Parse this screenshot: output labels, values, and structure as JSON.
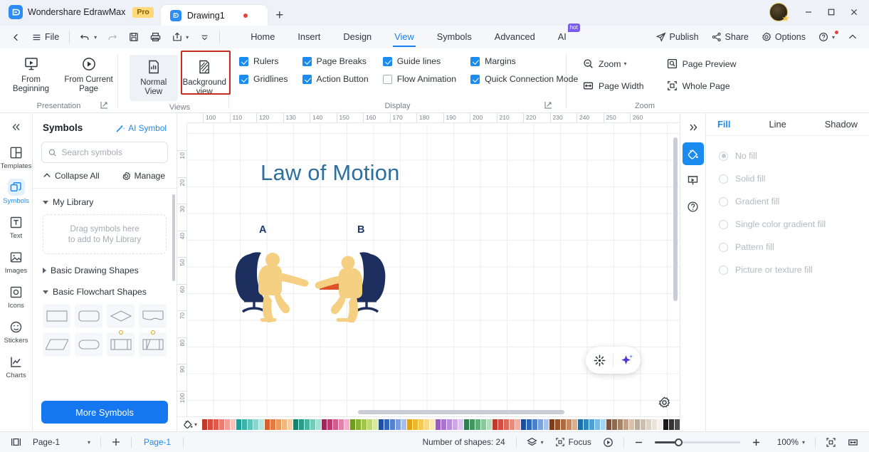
{
  "titlebar": {
    "brand_name": "Wondershare EdrawMax",
    "pro_badge": "Pro",
    "document_tab": "Drawing1",
    "new_tab_label": "+",
    "minimize_label": "–",
    "maximize_label": "□",
    "close_label": "✕"
  },
  "menurow": {
    "back_label": "‹",
    "file_label": "File",
    "tabs": [
      {
        "label": "Home",
        "active": false
      },
      {
        "label": "Insert",
        "active": false
      },
      {
        "label": "Design",
        "active": false
      },
      {
        "label": "View",
        "active": true
      },
      {
        "label": "Symbols",
        "active": false
      },
      {
        "label": "Advanced",
        "active": false
      },
      {
        "label": "AI",
        "active": false,
        "badge": "hot"
      }
    ],
    "publish_label": "Publish",
    "share_label": "Share",
    "options_label": "Options",
    "help_label": "?",
    "collapse_label": "^"
  },
  "ribbon": {
    "presentation": {
      "group_label": "Presentation",
      "from_beginning": "From\nBeginning",
      "from_beginning_line1": "From",
      "from_beginning_line2": "Beginning",
      "from_current_line1": "From Current",
      "from_current_line2": "Page"
    },
    "views": {
      "group_label": "Views",
      "normal_line1": "Normal",
      "normal_line2": "View",
      "background_line1": "Background",
      "background_line2": "view",
      "highlighted": "Background view"
    },
    "display": {
      "group_label": "Display",
      "items": [
        {
          "label": "Rulers",
          "checked": true
        },
        {
          "label": "Page Breaks",
          "checked": true
        },
        {
          "label": "Guide lines",
          "checked": true
        },
        {
          "label": "Margins",
          "checked": true
        },
        {
          "label": "Gridlines",
          "checked": true
        },
        {
          "label": "Action Button",
          "checked": true
        },
        {
          "label": "Flow Animation",
          "checked": false
        },
        {
          "label": "Quick Connection Mode",
          "checked": true
        }
      ]
    },
    "zoom": {
      "group_label": "Zoom",
      "items": [
        {
          "label": "Zoom",
          "dropdown": true
        },
        {
          "label": "Page Preview",
          "dropdown": false
        },
        {
          "label": "Page Width",
          "dropdown": false
        },
        {
          "label": "Whole Page",
          "dropdown": false
        }
      ]
    }
  },
  "rail": {
    "collapse_label": "«",
    "items": [
      {
        "label": "Templates",
        "icon": "templates-icon",
        "active": false
      },
      {
        "label": "Symbols",
        "icon": "symbols-icon",
        "active": true
      },
      {
        "label": "Text",
        "icon": "text-icon",
        "active": false
      },
      {
        "label": "Images",
        "icon": "images-icon",
        "active": false
      },
      {
        "label": "Icons",
        "icon": "icons-icon",
        "active": false
      },
      {
        "label": "Stickers",
        "icon": "stickers-icon",
        "active": false
      },
      {
        "label": "Charts",
        "icon": "charts-icon",
        "active": false
      }
    ]
  },
  "symbols_panel": {
    "title": "Symbols",
    "ai_symbol": "AI Symbol",
    "search_placeholder": "Search symbols",
    "search_value": "",
    "collapse_all": "Collapse All",
    "manage": "Manage",
    "sections": [
      {
        "label": "My Library",
        "expanded": true
      },
      {
        "label": "Basic Drawing Shapes",
        "expanded": false
      },
      {
        "label": "Basic Flowchart Shapes",
        "expanded": true
      }
    ],
    "dropzone_line1": "Drag symbols here",
    "dropzone_line2": "to add to My Library",
    "more_symbols": "More Symbols"
  },
  "canvas": {
    "ruler_h_ticks": [
      "100",
      "110",
      "120",
      "130",
      "140",
      "150",
      "160",
      "170",
      "180",
      "190",
      "200",
      "210",
      "220",
      "230",
      "240",
      "250",
      "260"
    ],
    "ruler_v_ticks": [
      "10",
      "20",
      "30",
      "40",
      "50",
      "60",
      "70",
      "80",
      "90",
      "100"
    ],
    "title_text": "Law of Motion",
    "label_a": "A",
    "label_b": "B",
    "colors": {
      "title": "#2e6f9e",
      "chair": "#1c2f5e",
      "person": "#f5d083",
      "arrow": "#e0522a",
      "label": "#1e3a6b"
    },
    "fill_tool_label": "fill-bucket",
    "ai_beautify_icon": "sparkle-burst-icon",
    "ai_magic_icon": "ai-sparkle-icon",
    "settings_icon": "gear-icon"
  },
  "right_panel": {
    "expand_label": "»",
    "rail_icons": [
      {
        "name": "fill-bucket-icon",
        "active": true
      },
      {
        "name": "presentation-icon",
        "active": false
      },
      {
        "name": "help-circle-icon",
        "active": false
      }
    ],
    "tabs": [
      {
        "label": "Fill",
        "active": true
      },
      {
        "label": "Line",
        "active": false
      },
      {
        "label": "Shadow",
        "active": false
      }
    ],
    "fill_options": [
      {
        "label": "No fill",
        "selected": true
      },
      {
        "label": "Solid fill",
        "selected": false
      },
      {
        "label": "Gradient fill",
        "selected": false
      },
      {
        "label": "Single color gradient fill",
        "selected": false
      },
      {
        "label": "Pattern fill",
        "selected": false
      },
      {
        "label": "Picture or texture fill",
        "selected": false
      }
    ]
  },
  "statusbar": {
    "page_selector": "Page-1",
    "add_page_label": "+",
    "page_tab": "Page-1",
    "shape_count": "Number of shapes: 24",
    "layers_label": "layers-icon",
    "focus_label": "Focus",
    "presentation_label": "presentation-play-icon",
    "zoom_out_label": "−",
    "zoom_in_label": "+",
    "zoom_level": "100%",
    "fit_page_label": "fit-page-icon",
    "fit_width_label": "fit-width-icon"
  },
  "palette": {
    "swatches": [
      "#c0392b",
      "#d94b3e",
      "#e05a4c",
      "#e87d72",
      "#ef9e98",
      "#f5c3c0",
      "#1e9e94",
      "#3bb3a8",
      "#5fc4ba",
      "#8dd6cf",
      "#b6e5e0",
      "#d95f2e",
      "#e37b42",
      "#eb9a5e",
      "#f2b681",
      "#f7cfa6",
      "#17826f",
      "#2a9c86",
      "#48b49f",
      "#74cbba",
      "#a5dfd3",
      "#a0275c",
      "#bc3a73",
      "#cf5d8f",
      "#e084ad",
      "#f0b0cb",
      "#6e9c23",
      "#87b232",
      "#a0c64c",
      "#bcd973",
      "#d7e9a4",
      "#1f4fa5",
      "#3465bb",
      "#5580cd",
      "#7d9dda",
      "#a9bfe8",
      "#e0a417",
      "#edb82e",
      "#f3c957",
      "#f8da86",
      "#fbe9b4",
      "#9a5cbf",
      "#ab74cb",
      "#bb8dd6",
      "#cca8e1",
      "#ddc4ec",
      "#2f7d52",
      "#42965f",
      "#5fae78",
      "#8bc69c",
      "#b6dcc0",
      "#c0392b",
      "#d34e40",
      "#dd6b5d",
      "#e68d81",
      "#eeb0a7",
      "#1b4f9c",
      "#2c66b6",
      "#4a81c8",
      "#7ba2d9",
      "#aac2e7",
      "#7a3f1a",
      "#96512a",
      "#ad6a3f",
      "#c38a64",
      "#d9af91",
      "#1c6fa8",
      "#2f87c0",
      "#4ea0d3",
      "#79bce2",
      "#a7d5ef",
      "#7a5542",
      "#8f6a52",
      "#a68468",
      "#c0a288",
      "#d8c1ac",
      "#b8ac9c",
      "#cabfb2",
      "#dbd3c8",
      "#e9e3db",
      "#f4f1ec",
      "#1a1a1a",
      "#333333",
      "#4d4d4d",
      "#666666",
      "#808080",
      "#999999",
      "#b3b3b3",
      "#cccccc",
      "#e0e0e0",
      "#f2f2f2",
      "#ffffff"
    ]
  }
}
